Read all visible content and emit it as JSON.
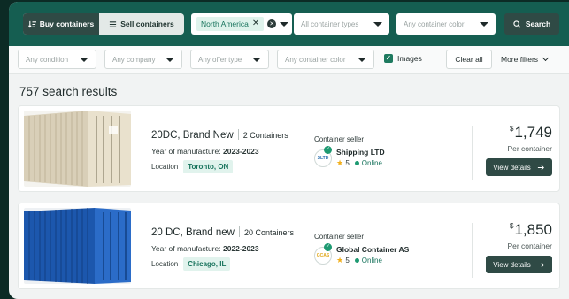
{
  "topbar": {
    "buy_label": "Buy containers",
    "sell_label": "Sell containers",
    "region_chip": "North America",
    "container_types_placeholder": "All container types",
    "container_color_placeholder": "Any container color",
    "search_label": "Search"
  },
  "filters": {
    "condition_placeholder": "Any condition",
    "company_placeholder": "Any company",
    "offer_type_placeholder": "Any offer type",
    "container_color_placeholder": "Any container color",
    "images_label": "Images",
    "clear_all_label": "Clear all",
    "more_filters_label": "More filters"
  },
  "results": {
    "count_text": "757 search results",
    "items": [
      {
        "title": "20DC, Brand New",
        "count": "2 Containers",
        "yom_label": "Year of manufacture:",
        "yom_value": "2023-2023",
        "location_label": "Location",
        "location_value": "Toronto, ON",
        "seller_label": "Container seller",
        "seller_avatar": "SLTD",
        "seller_name": "Shipping LTD",
        "rating": "5",
        "status": "Online",
        "currency": "$",
        "price": "1,749",
        "per": "Per container",
        "details_label": "View details",
        "container_color": "#e8e1d0"
      },
      {
        "title": "20 DC, Brand new",
        "count": "20 Containers",
        "yom_label": "Year of manufacture:",
        "yom_value": "2022-2023",
        "location_label": "Location",
        "location_value": "Chicago, IL",
        "seller_label": "Container seller",
        "seller_avatar": "GCAS",
        "seller_name": "Global Container AS",
        "rating": "5",
        "status": "Online",
        "currency": "$",
        "price": "1,850",
        "per": "Per container",
        "details_label": "View details",
        "container_color": "#1f5fb8"
      }
    ]
  },
  "colors": {
    "header_bg": "#155e51",
    "accent_dark": "#2f4a45",
    "accent_green": "#17735c",
    "star": "#f2b01e"
  }
}
